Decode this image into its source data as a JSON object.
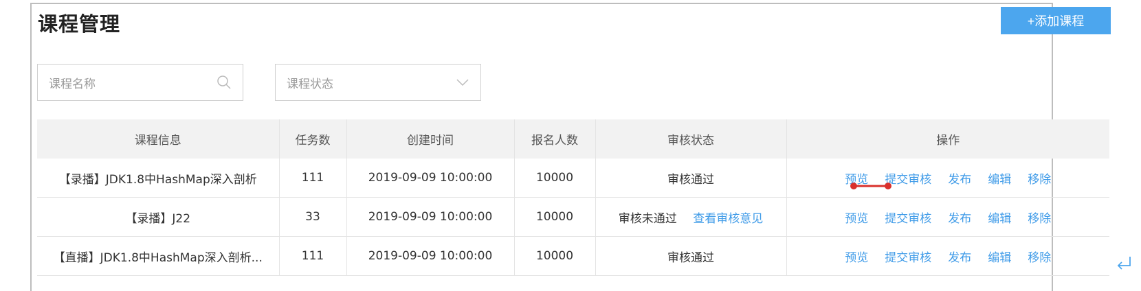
{
  "header": {
    "title": "课程管理",
    "add_button": "+添加课程"
  },
  "filters": {
    "search_placeholder": "课程名称",
    "status_placeholder": "课程状态"
  },
  "table": {
    "columns": [
      "课程信息",
      "任务数",
      "创建时间",
      "报名人数",
      "审核状态",
      "操作"
    ],
    "rows": [
      {
        "info": "【录播】JDK1.8中HashMap深入剖析",
        "tasks": "111",
        "created": "2019-09-09 10:00:00",
        "enrolled": "10000",
        "status": "审核通过",
        "review_link": ""
      },
      {
        "info": "【录播】J22",
        "tasks": "33",
        "created": "2019-09-09 10:00:00",
        "enrolled": "10000",
        "status": "审核未通过",
        "review_link": "查看审核意见"
      },
      {
        "info": "【直播】JDK1.8中HashMap深入剖析...",
        "tasks": "111",
        "created": "2019-09-09 10:00:00",
        "enrolled": "10000",
        "status": "审核通过",
        "review_link": ""
      }
    ],
    "actions": [
      "预览",
      "提交审核",
      "发布",
      "编辑",
      "移除"
    ]
  },
  "colors": {
    "accent": "#4ca6ee",
    "link": "#3f9be8",
    "annotation": "#d9302c"
  },
  "icons": {
    "search": "search-icon",
    "dropdown": "chevron-down-icon",
    "return": "return-arrow-icon"
  }
}
